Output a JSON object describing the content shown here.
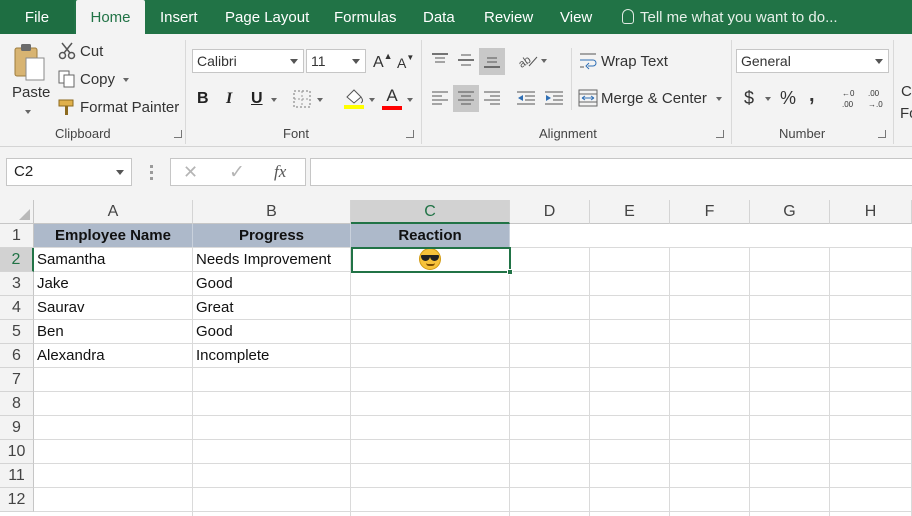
{
  "tabs": {
    "file": "File",
    "home": "Home",
    "insert": "Insert",
    "page_layout": "Page Layout",
    "formulas": "Formulas",
    "data": "Data",
    "review": "Review",
    "view": "View",
    "tell_me": "Tell me what you want to do..."
  },
  "clipboard": {
    "paste": "Paste",
    "cut": "Cut",
    "copy": "Copy",
    "format_painter": "Format Painter",
    "label": "Clipboard"
  },
  "font": {
    "name": "Calibri",
    "size": "11",
    "bold": "B",
    "italic": "I",
    "underline": "U",
    "label": "Font",
    "highlight_color": "#ffff00",
    "font_color": "#ff0000"
  },
  "alignment": {
    "wrap_text": "Wrap Text",
    "merge_center": "Merge & Center",
    "label": "Alignment"
  },
  "number": {
    "format": "General",
    "currency": "$",
    "percent": "%",
    "comma": ",",
    "label": "Number"
  },
  "styles_cutoff": {
    "line1": "C",
    "line2": "Fo"
  },
  "formula_bar": {
    "name_box": "C2",
    "cancel": "✕",
    "enter": "✓",
    "fx": "fx",
    "value": ""
  },
  "grid": {
    "columns": [
      "A",
      "B",
      "C",
      "D",
      "E",
      "F",
      "G",
      "H"
    ],
    "rows": [
      "1",
      "2",
      "3",
      "4",
      "5",
      "6",
      "7",
      "8",
      "9",
      "10",
      "11",
      "12"
    ],
    "header": [
      "Employee Name",
      "Progress",
      "Reaction"
    ],
    "data": [
      [
        "Samantha",
        "Needs Improvement",
        "😎"
      ],
      [
        "Jake",
        "Good",
        ""
      ],
      [
        "Saurav",
        "Great",
        ""
      ],
      [
        "Ben",
        "Good",
        ""
      ],
      [
        "Alexandra",
        "Incomplete",
        ""
      ]
    ],
    "selected_cell": "C2",
    "header_fill": "#adb9ca",
    "accent": "#217346"
  }
}
